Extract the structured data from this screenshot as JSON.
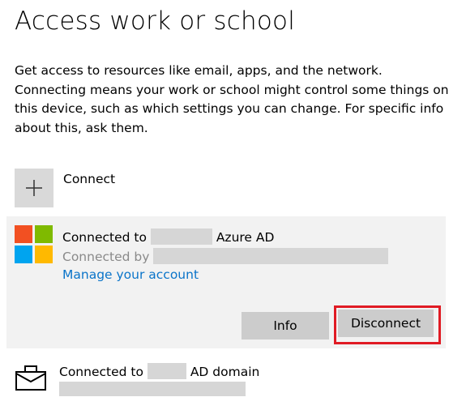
{
  "page": {
    "title": "Access work or school",
    "description": "Get access to resources like email, apps, and the network. Connecting means your work or school might control some things on this device, such as which settings you can change. For specific info about this, ask them."
  },
  "connect": {
    "label": "Connect",
    "icon": "plus-icon"
  },
  "accounts": [
    {
      "icon": "microsoft-logo",
      "connected_prefix": "Connected to",
      "connected_suffix": "Azure AD",
      "connected_by_prefix": "Connected by",
      "manage_link": "Manage your account",
      "buttons": {
        "info": "Info",
        "disconnect": "Disconnect"
      },
      "highlight_color": "#e01b24"
    },
    {
      "icon": "briefcase-icon",
      "connected_prefix": "Connected to",
      "connected_suffix": "AD domain"
    }
  ],
  "colors": {
    "link": "#0a74c9",
    "card_background": "#f2f2f2",
    "button_background": "#cccccc",
    "ms_red": "#f25022",
    "ms_green": "#7fba00",
    "ms_blue": "#00a4ef",
    "ms_yellow": "#ffb900"
  }
}
